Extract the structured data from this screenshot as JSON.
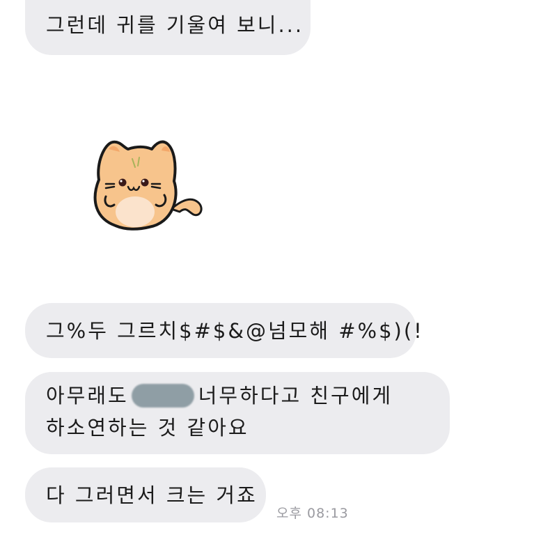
{
  "messages": [
    {
      "text": "그런데 귀를 기울여 보니..."
    },
    {
      "sticker": "orange-cat-sticker"
    },
    {
      "text": "그%두 그르치$#$&@넘모해 #%$)(!"
    },
    {
      "line1_before": "아무래도",
      "line1_after": "너무하다고 친구에게",
      "line2": "하소연하는 것 같아요",
      "redacted": true
    },
    {
      "text": "다 그러면서 크는 거죠"
    }
  ],
  "timestamp": "오후 08:13",
  "colors": {
    "bubble": "#ececef",
    "text": "#1b1b1b",
    "timestamp": "#9a9aa0",
    "redaction": "#8f9ea5",
    "cat_fur": "#f7c48c",
    "cat_outline": "#1a1a1a"
  }
}
